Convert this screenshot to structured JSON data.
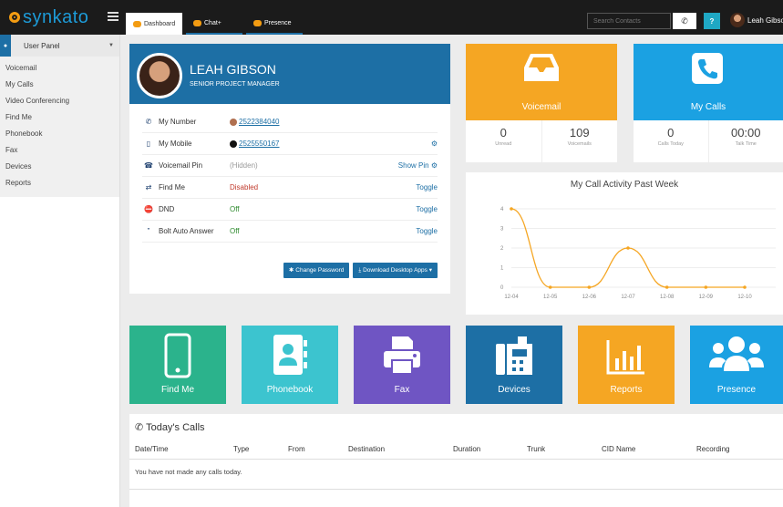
{
  "app": {
    "logo_text": "synkato",
    "tabs": [
      {
        "label": "Dashboard",
        "color": "#f39c12"
      },
      {
        "label": "Chat+",
        "color": "#f39c12"
      },
      {
        "label": "Presence",
        "color": "#f39c12"
      }
    ],
    "search_placeholder": "Search Contacts",
    "help_label": "?",
    "user_name": "Leah Gibso"
  },
  "sidebar": {
    "header": "User Panel",
    "items": [
      "Voicemail",
      "My Calls",
      "Video Conferencing",
      "Find Me",
      "Phonebook",
      "Fax",
      "Devices",
      "Reports"
    ]
  },
  "profile": {
    "name": "LEAH GIBSON",
    "title": "SENIOR PROJECT MANAGER",
    "rows": [
      {
        "label": "My Number",
        "value": "2522384040"
      },
      {
        "label": "My Mobile",
        "value": "2525550167"
      },
      {
        "label": "Voicemail Pin",
        "value": "(Hidden)",
        "action": "Show Pin"
      },
      {
        "label": "Find Me",
        "value": "Disabled",
        "action": "Toggle"
      },
      {
        "label": "DND",
        "value": "Off",
        "action": "Toggle"
      },
      {
        "label": "Bolt Auto Answer",
        "value": "Off",
        "action": "Toggle"
      }
    ],
    "buttons": {
      "change_password": "Change Password",
      "download": "Download Desktop Apps"
    }
  },
  "voicemail_tile": {
    "label": "Voicemail",
    "color": "#f5a623",
    "stats": [
      {
        "num": "0",
        "sub": "Unread"
      },
      {
        "num": "109",
        "sub": "Voicemails"
      }
    ]
  },
  "mycalls_tile": {
    "label": "My Calls",
    "color": "#1ba1e2",
    "stats": [
      {
        "num": "0",
        "sub": "Calls Today"
      },
      {
        "num": "00:00",
        "sub": "Talk Time"
      }
    ]
  },
  "chart_data": {
    "type": "line",
    "title": "My Call Activity Past Week",
    "categories": [
      "12-04",
      "12-05",
      "12-06",
      "12-07",
      "12-08",
      "12-09",
      "12-10"
    ],
    "values": [
      4,
      0,
      0,
      2,
      0,
      0,
      0
    ],
    "ylim": [
      0,
      4
    ],
    "yticks": [
      "0",
      "1",
      "2",
      "3",
      "4"
    ],
    "color": "#f5a623",
    "grid": true
  },
  "tiles": [
    {
      "label": "Find Me",
      "color": "#2bb38c",
      "icon": "mobile-phone-icon"
    },
    {
      "label": "Phonebook",
      "color": "#3cc4cf",
      "icon": "address-book-icon"
    },
    {
      "label": "Fax",
      "color": "#6f55c3",
      "icon": "printer-icon"
    },
    {
      "label": "Devices",
      "color": "#1d6fa5",
      "icon": "fax-machine-icon"
    },
    {
      "label": "Reports",
      "color": "#f5a623",
      "icon": "bar-chart-icon"
    },
    {
      "label": "Presence",
      "color": "#1ba1e2",
      "icon": "users-icon"
    }
  ],
  "calls": {
    "title": "Today's Calls",
    "columns": [
      "Date/Time",
      "Type",
      "From",
      "Destination",
      "Duration",
      "Trunk",
      "CID Name",
      "Recording"
    ],
    "empty_message": "You have not made any calls today."
  }
}
